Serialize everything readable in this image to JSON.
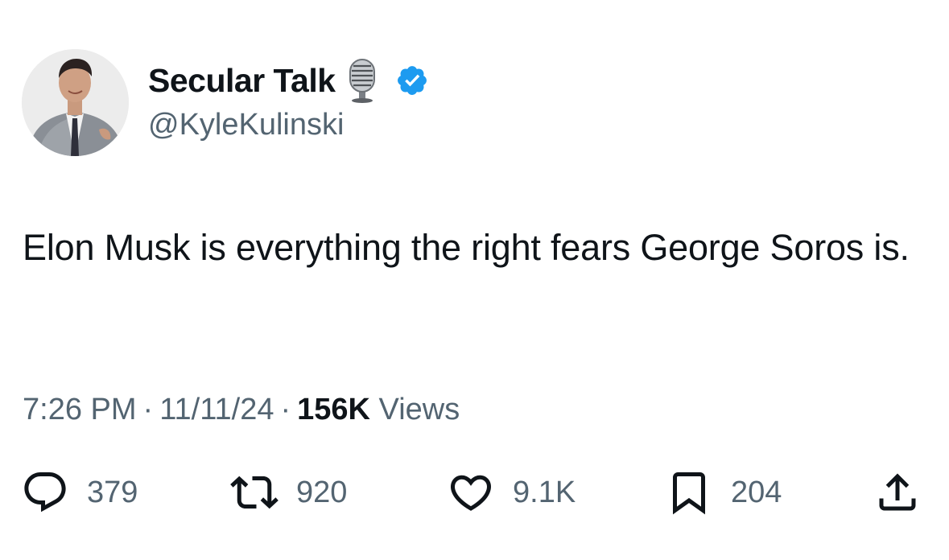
{
  "author": {
    "display_name": "Secular Talk",
    "handle": "@KyleKulinski",
    "name_emoji": "microphone-emoji",
    "verified_badge": "verified-check-icon",
    "verified_color": "#1d9bf0"
  },
  "tweet": {
    "text": "Elon Musk is everything the right fears George Soros is.",
    "time": "7:26 PM",
    "date": "11/11/24",
    "views_count": "156K",
    "views_label": "Views"
  },
  "actions": {
    "replies": "379",
    "reposts": "920",
    "likes": "9.1K",
    "bookmarks": "204"
  },
  "colors": {
    "text_primary": "#0f1419",
    "text_secondary": "#536471",
    "background": "#ffffff"
  }
}
